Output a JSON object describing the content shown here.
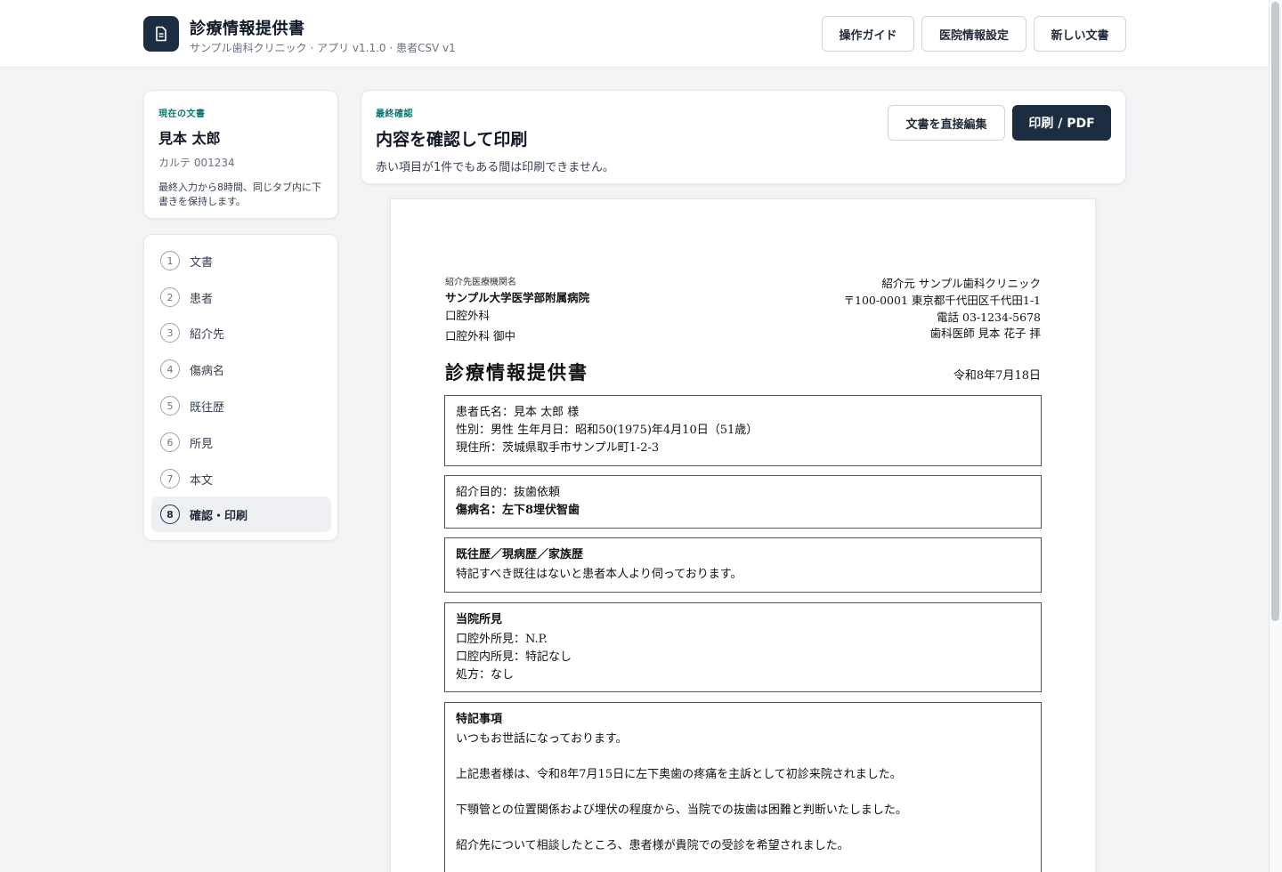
{
  "header": {
    "title": "診療情報提供書",
    "subtitle": "サンプル歯科クリニック · アプリ v1.1.0 · 患者CSV v1",
    "buttons": {
      "guide": "操作ガイド",
      "clinic_settings": "医院情報設定",
      "new_doc": "新しい文書"
    }
  },
  "current": {
    "eyebrow": "現在の文書",
    "patient_name": "見本 太郎",
    "chart_no": "カルテ 001234",
    "note": "最終入力から8時間、同じタブ内に下書きを保持します。"
  },
  "steps": [
    {
      "num": "1",
      "label": "文書"
    },
    {
      "num": "2",
      "label": "患者"
    },
    {
      "num": "3",
      "label": "紹介先"
    },
    {
      "num": "4",
      "label": "傷病名"
    },
    {
      "num": "5",
      "label": "既往歴"
    },
    {
      "num": "6",
      "label": "所見"
    },
    {
      "num": "7",
      "label": "本文"
    },
    {
      "num": "8",
      "label": "確認・印刷",
      "active": true
    }
  ],
  "main": {
    "eyebrow": "最終確認",
    "title": "内容を確認して印刷",
    "subtitle": "赤い項目が1件でもある間は印刷できません。",
    "edit_button": "文書を直接編集",
    "print_button": "印刷 / PDF"
  },
  "document": {
    "to_label": "紹介先医療機関名",
    "to_hospital": "サンプル大学医学部附属病院",
    "to_dept": "口腔外科",
    "to_recipient": "口腔外科 御中",
    "from_clinic": "紹介元 サンプル歯科クリニック",
    "from_address": "〒100-0001 東京都千代田区千代田1-1",
    "from_phone": "電話 03-1234-5678",
    "from_doctor": "歯科医師 見本 花子 拝",
    "title": "診療情報提供書",
    "date": "令和8年7月18日",
    "patient_line": "患者氏名：見本 太郎 様",
    "sex_dob_line": "性別：男性 生年月日：昭和50(1975)年4月10日（51歳）",
    "address_line": "現住所：茨城県取手市サンプル町1-2-3",
    "purpose_line": "紹介目的：抜歯依頼",
    "diagnosis_line": "傷病名：左下8埋伏智歯",
    "history_heading": "既往歴／現病歴／家族歴",
    "history_text": "特記すべき既往はないと患者本人より伺っております。",
    "findings_heading": "当院所見",
    "findings_extraoral": "口腔外所見：N.P.",
    "findings_intraoral": "口腔内所見：特記なし",
    "findings_rx": "処方：なし",
    "notes_heading": "特記事項",
    "notes_p1": "いつもお世話になっております。",
    "notes_p2": "上記患者様は、令和8年7月15日に左下奥歯の疼痛を主訴として初診来院されました。",
    "notes_p3": "下顎管との位置関係および埋伏の程度から、当院での抜歯は困難と判断いたしました。",
    "notes_p4": "紹介先について相談したところ、患者様が貴院での受診を希望されました。"
  }
}
